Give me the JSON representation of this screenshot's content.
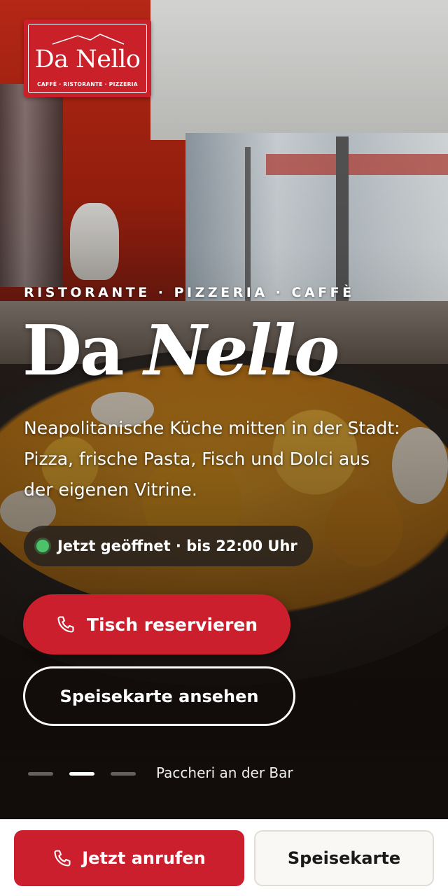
{
  "logo": {
    "name": "Da Nello",
    "tagline": "CAFFÈ · RISTORANTE · PIZZERIA"
  },
  "hero": {
    "eyebrow": "RISTORANTE · PIZZERIA · CAFFÈ",
    "title_part1": "Da ",
    "title_part2": "Nello",
    "subtitle": "Neapolitanische Küche mitten in der Stadt: Pizza, frische Pasta, Fisch und Dolci aus der eigenen Vitrine.",
    "status": "Jetzt geöffnet · bis 22:00 Uhr",
    "status_color": "#4cc36b",
    "reserve_label": "Tisch reservieren",
    "menu_label": "Speisekarte ansehen",
    "slides": {
      "count": 3,
      "active": 2
    },
    "caption": "Paccheri an der Bar"
  },
  "bottom_bar": {
    "call_label": "Jetzt anrufen",
    "menu_label": "Speisekarte"
  },
  "colors": {
    "brand_red": "#cb1f2d",
    "status_green": "#4cc36b"
  },
  "icons": {
    "reserve": "phone-icon",
    "call": "phone-icon"
  }
}
